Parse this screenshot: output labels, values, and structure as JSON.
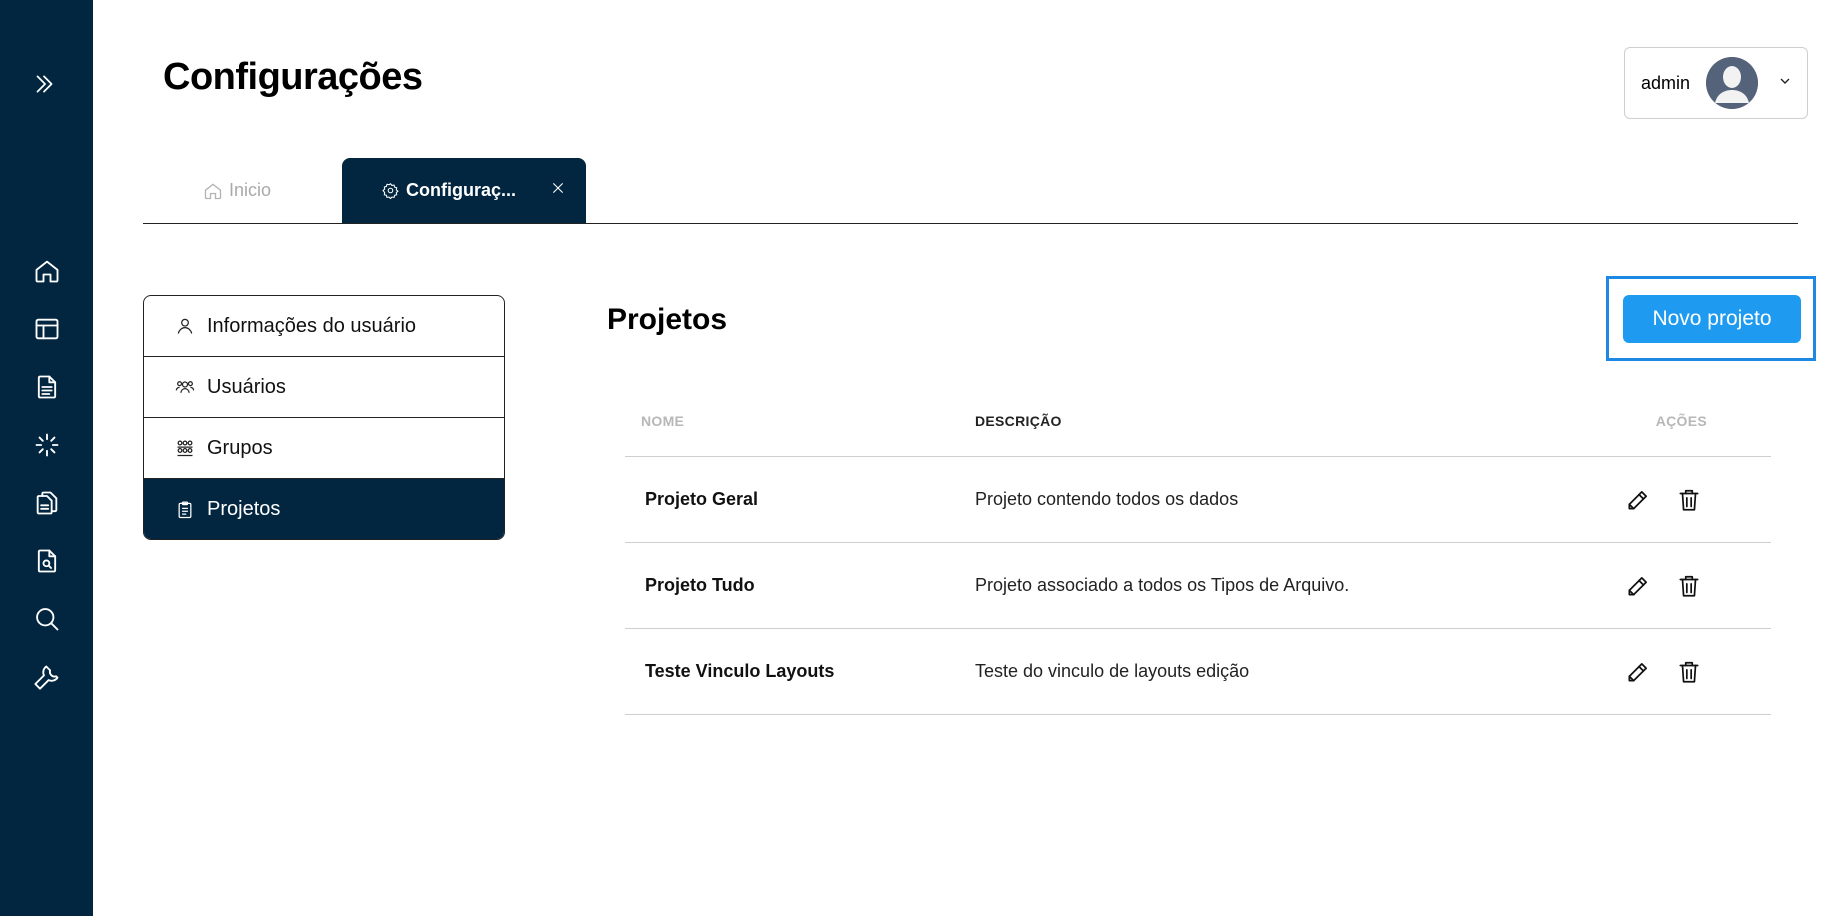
{
  "page": {
    "title": "Configurações"
  },
  "user": {
    "name": "admin",
    "avatar_icon": "user-avatar-icon"
  },
  "sidebar": {
    "expand_icon": "double-chevron-right-icon",
    "items": [
      {
        "name": "home",
        "icon": "home-icon"
      },
      {
        "name": "layouts",
        "icon": "layout-icon"
      },
      {
        "name": "documents",
        "icon": "document-icon"
      },
      {
        "name": "processing",
        "icon": "loader-icon"
      },
      {
        "name": "files",
        "icon": "files-icon"
      },
      {
        "name": "file-search",
        "icon": "file-search-icon"
      },
      {
        "name": "search",
        "icon": "search-icon"
      },
      {
        "name": "tools",
        "icon": "wrench-icon"
      }
    ]
  },
  "tabs": [
    {
      "label": "Inicio",
      "icon": "home-icon",
      "active": false
    },
    {
      "label": "Configuraç...",
      "icon": "gear-icon",
      "active": true,
      "closable": true
    }
  ],
  "settings_menu": [
    {
      "label": "Informações do usuário",
      "icon": "user-icon",
      "active": false
    },
    {
      "label": "Usuários",
      "icon": "users-icon",
      "active": false
    },
    {
      "label": "Grupos",
      "icon": "groups-icon",
      "active": false
    },
    {
      "label": "Projetos",
      "icon": "clipboard-icon",
      "active": true
    }
  ],
  "section": {
    "title": "Projetos",
    "new_button_label": "Novo projeto"
  },
  "table": {
    "headers": {
      "name": "NOME",
      "description": "DESCRIÇÃO",
      "actions": "AÇÕES"
    },
    "rows": [
      {
        "name": "Projeto Geral",
        "description": "Projeto contendo todos os dados"
      },
      {
        "name": "Projeto Tudo",
        "description": "Projeto associado a todos os Tipos de Arquivo."
      },
      {
        "name": "Teste Vinculo Layouts",
        "description": "Teste do vinculo de layouts edição"
      }
    ],
    "action_icons": [
      "pencil-icon",
      "trash-icon"
    ]
  },
  "colors": {
    "sidebar_bg": "#022640",
    "primary_button": "#1e9bf0",
    "highlight_border": "#1e88e5"
  }
}
